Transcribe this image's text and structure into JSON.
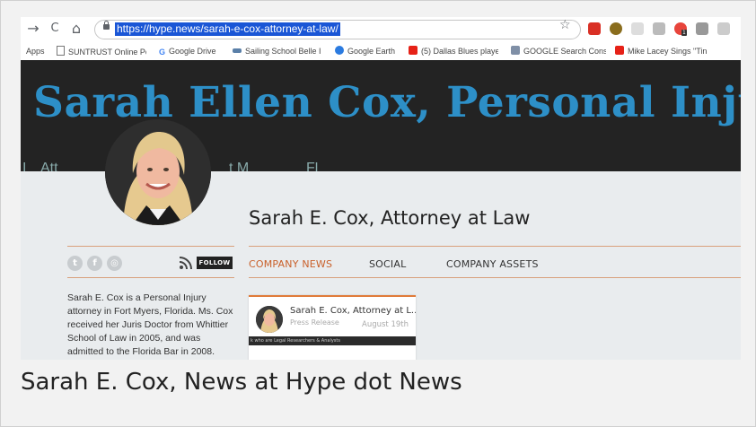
{
  "browser": {
    "url": "https://hype.news/sarah-e-cox-attorney-at-law/",
    "back_glyph": "→",
    "reload_glyph": "C",
    "home_glyph": "⌂",
    "star_glyph": "☆"
  },
  "bookmarks": [
    {
      "label": "Apps",
      "icon": "apps-icon"
    },
    {
      "label": "SUNTRUST Online Pe",
      "icon": "document-icon"
    },
    {
      "label": "Google Drive",
      "icon": "google-g-icon"
    },
    {
      "label": "Sailing School Belle I",
      "icon": "boat-icon"
    },
    {
      "label": "Google Earth",
      "icon": "earth-icon"
    },
    {
      "label": "(5) Dallas Blues playe",
      "icon": "youtube-icon"
    },
    {
      "label": "GOOGLE Search Cons",
      "icon": "search-console-icon"
    },
    {
      "label": "Mike Lacey Sings \"Tin",
      "icon": "youtube-icon"
    }
  ],
  "banner": {
    "title": "Sarah Ellen Cox, Personal Injury L",
    "subtitle_fragments": [
      "I",
      "Att",
      "t M",
      "Fl"
    ]
  },
  "profile": {
    "name": "Sarah E. Cox, Attorney at Law",
    "follow_label": "FOLLOW",
    "social_icons": [
      "twitter-icon",
      "facebook-icon",
      "instagram-icon"
    ]
  },
  "tabs": [
    {
      "label": "COMPANY NEWS",
      "active": true
    },
    {
      "label": "SOCIAL",
      "active": false
    },
    {
      "label": "COMPANY ASSETS",
      "active": false
    }
  ],
  "bio": "Sarah E. Cox is a Personal Injury attorney in Fort Myers, Florida. Ms. Cox received her Juris Doctor from Whittier School of Law in 2005, and was admitted to the Florida Bar in 2008.",
  "news_card": {
    "title": "Sarah E. Cox, Attorney at L...",
    "type": "Press Release",
    "date": "August 19th",
    "strip_text": "k who are Legal Researchers & Analysts"
  },
  "caption": "Sarah E. Cox, News at Hype dot News",
  "colors": {
    "banner_bg": "#232323",
    "banner_title": "#2d8fc7",
    "accent": "#c9602a",
    "page_bg": "#e9ecee"
  }
}
